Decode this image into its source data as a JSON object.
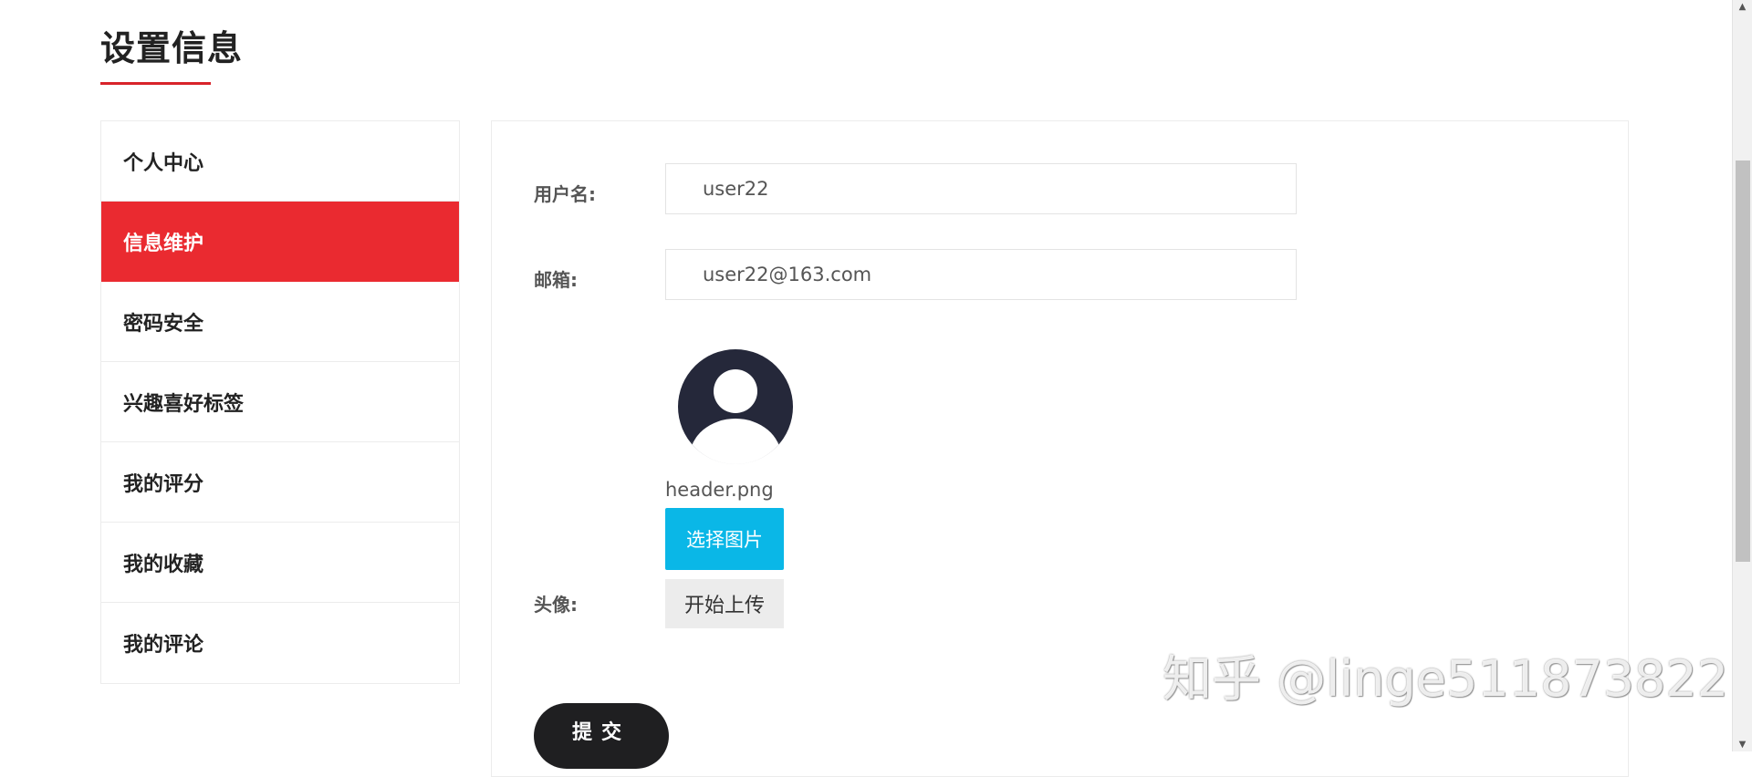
{
  "page": {
    "title": "设置信息"
  },
  "sidebar": {
    "items": [
      {
        "label": "个人中心",
        "active": false
      },
      {
        "label": "信息维护",
        "active": true
      },
      {
        "label": "密码安全",
        "active": false
      },
      {
        "label": "兴趣喜好标签",
        "active": false
      },
      {
        "label": "我的评分",
        "active": false
      },
      {
        "label": "我的收藏",
        "active": false
      },
      {
        "label": "我的评论",
        "active": false
      }
    ]
  },
  "form": {
    "username_label": "用户名:",
    "username_value": "user22",
    "email_label": "邮箱:",
    "email_value": "user22@163.com",
    "avatar_label": "头像:",
    "file_name": "header.png",
    "choose_button": "选择图片",
    "upload_button": "开始上传",
    "submit_button": "提交"
  },
  "watermark": "知乎 @linge511873822",
  "colors": {
    "accent": "#ea2a30",
    "choose_button": "#0ab7e7",
    "submit_button": "#1f1f21",
    "avatar": "#25283a"
  }
}
